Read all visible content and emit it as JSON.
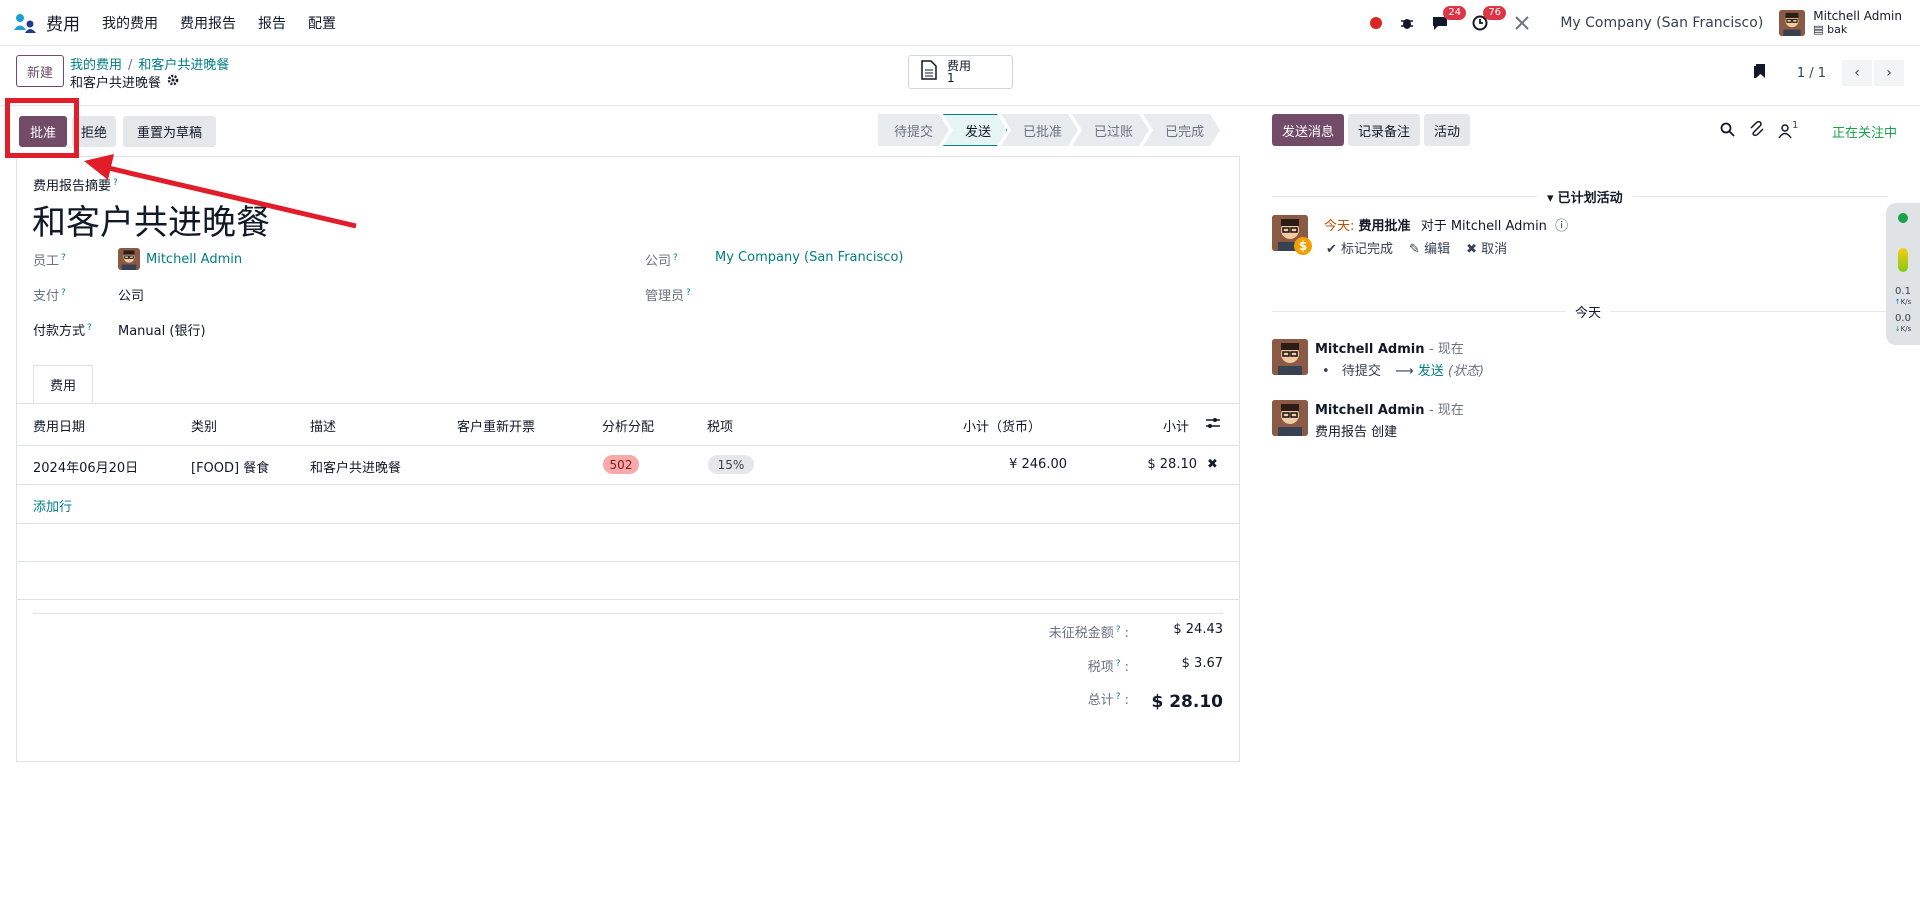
{
  "nav": {
    "app_name": "费用",
    "menu": [
      "我的费用",
      "费用报告",
      "报告",
      "配置"
    ],
    "chat_badge": "24",
    "activity_badge": "76",
    "company": "My Company (San Francisco)",
    "user_name": "Mitchell Admin",
    "user_db": "bak"
  },
  "control": {
    "new_label": "新建",
    "breadcrumb_parent": "我的费用",
    "breadcrumb_current": "和客户共进晚餐",
    "record_name": "和客户共进晚餐",
    "smart_label": "费用",
    "smart_count": "1",
    "pager": "1 / 1"
  },
  "status": {
    "approve": "批准",
    "reject": "拒绝",
    "reset": "重置为草稿",
    "stages": [
      "待提交",
      "发送",
      "已批准",
      "已过账",
      "已完成"
    ],
    "active_stage": "发送"
  },
  "form": {
    "summary_label": "费用报告摘要",
    "title": "和客户共进晚餐",
    "employee_label": "员工",
    "employee": "Mitchell Admin",
    "payment_label": "支付",
    "payment": "公司",
    "method_label": "付款方式",
    "method": "Manual (银行)",
    "company_label": "公司",
    "company": "My Company (San Francisco)",
    "manager_label": "管理员",
    "tab": "费用",
    "columns": [
      "费用日期",
      "类别",
      "描述",
      "客户重新开票",
      "分析分配",
      "税项",
      "小计（货币）",
      "小计"
    ],
    "row": {
      "date": "2024年06月20日",
      "category": "[FOOD] 餐食",
      "description": "和客户共进晚餐",
      "analytic": "502",
      "tax": "15%",
      "subtotal_currency": "¥ 246.00",
      "subtotal": "$ 28.10"
    },
    "add_line": "添加行",
    "untaxed_label": "未征税金额",
    "untaxed": "$ 24.43",
    "tax_label": "税项",
    "tax_total": "$ 3.67",
    "total_label": "总计",
    "total": "$ 28.10"
  },
  "chatter": {
    "send": "发送消息",
    "note": "记录备注",
    "activity": "活动",
    "follower_count": "1",
    "following": "正在关注中",
    "planned": "已计划活动",
    "today_prefix": "今天:",
    "activity_type": "费用批准",
    "activity_for": "对于 Mitchell Admin",
    "mark_done": "标记完成",
    "edit": "编辑",
    "cancel": "取消",
    "today": "今天",
    "msg1_author": "Mitchell Admin",
    "msg1_time": "- 现在",
    "msg1_from": "待提交",
    "msg1_to": "发送",
    "msg1_field": "(状态)",
    "msg2_author": "Mitchell Admin",
    "msg2_time": "- 现在",
    "msg2_body": "费用报告 创建"
  },
  "widget": {
    "up": "0.1",
    "down": "0.0",
    "unit": "K/s"
  },
  "colors": {
    "brand": "#714B67",
    "link": "#017E84",
    "highlight": "#e11d2a"
  }
}
